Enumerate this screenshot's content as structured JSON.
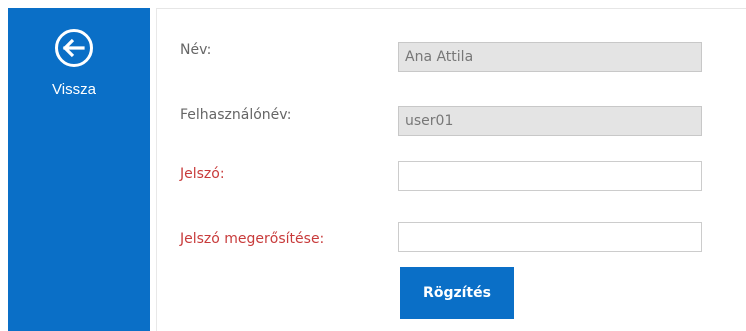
{
  "sidebar": {
    "back_label": "Vissza",
    "back_icon": "arrow-left-circle-icon",
    "color": "#0a6fc7"
  },
  "form": {
    "name": {
      "label": "Név:",
      "value": "Ana Attila"
    },
    "username": {
      "label": "Felhasználónév:",
      "value": "user01"
    },
    "password": {
      "label": "Jelszó:",
      "value": ""
    },
    "password_confirm": {
      "label": "Jelszó megerősítése:",
      "value": ""
    },
    "submit_label": "Rögzítés",
    "required_color": "#c83b3b"
  }
}
